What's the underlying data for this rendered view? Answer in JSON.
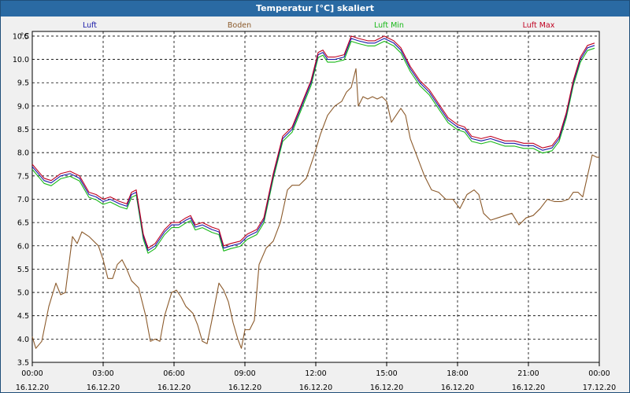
{
  "window": {
    "title": "Temperatur [°C] skaliert"
  },
  "chart_data": {
    "type": "line",
    "title": "Temperatur [°C] skaliert",
    "ylabel": "°C",
    "xlabel": "",
    "ylim": [
      3.5,
      10.6
    ],
    "xlim": [
      0,
      24
    ],
    "yticks": [
      3.5,
      4.0,
      4.5,
      5.0,
      5.5,
      6.0,
      6.5,
      7.0,
      7.5,
      8.0,
      8.5,
      9.0,
      9.5,
      10.0,
      10.5
    ],
    "ytick_labels": [
      "3.5",
      "4.0",
      "4.5",
      "5.0",
      "5.5",
      "6.0",
      "6.5",
      "7.0",
      "7.5",
      "8.0",
      "8.5",
      "9.0",
      "9.5",
      "10.0",
      "10.5"
    ],
    "xticks": [
      {
        "x": 0,
        "time": "00:00",
        "date": "16.12.20"
      },
      {
        "x": 3,
        "time": "03:00",
        "date": "16.12.20"
      },
      {
        "x": 6,
        "time": "06:00",
        "date": "16.12.20"
      },
      {
        "x": 9,
        "time": "09:00",
        "date": "16.12.20"
      },
      {
        "x": 12,
        "time": "12:00",
        "date": "16.12.20"
      },
      {
        "x": 15,
        "time": "15:00",
        "date": "16.12.20"
      },
      {
        "x": 18,
        "time": "18:00",
        "date": "16.12.20"
      },
      {
        "x": 21,
        "time": "21:00",
        "date": "16.12.20"
      },
      {
        "x": 24,
        "time": "00:00",
        "date": "17.12.20"
      }
    ],
    "grid": true,
    "legend_placement": "top",
    "series": [
      {
        "name": "Luft",
        "color": "#1a1aa8",
        "dy": 0.0,
        "points": [
          [
            0,
            7.7
          ],
          [
            0.5,
            7.4
          ],
          [
            0.8,
            7.35
          ],
          [
            1.2,
            7.5
          ],
          [
            1.6,
            7.55
          ],
          [
            2.0,
            7.45
          ],
          [
            2.4,
            7.1
          ],
          [
            2.7,
            7.05
          ],
          [
            3.0,
            6.95
          ],
          [
            3.3,
            7.0
          ],
          [
            3.7,
            6.9
          ],
          [
            4.0,
            6.85
          ],
          [
            4.2,
            7.1
          ],
          [
            4.4,
            7.15
          ],
          [
            4.7,
            6.2
          ],
          [
            4.9,
            5.9
          ],
          [
            5.2,
            6.0
          ],
          [
            5.6,
            6.3
          ],
          [
            5.9,
            6.45
          ],
          [
            6.2,
            6.45
          ],
          [
            6.5,
            6.55
          ],
          [
            6.7,
            6.6
          ],
          [
            6.9,
            6.4
          ],
          [
            7.2,
            6.45
          ],
          [
            7.6,
            6.35
          ],
          [
            7.9,
            6.3
          ],
          [
            8.1,
            5.95
          ],
          [
            8.4,
            6.0
          ],
          [
            8.8,
            6.05
          ],
          [
            9.1,
            6.2
          ],
          [
            9.5,
            6.3
          ],
          [
            9.8,
            6.55
          ],
          [
            10.2,
            7.5
          ],
          [
            10.6,
            8.3
          ],
          [
            11.0,
            8.5
          ],
          [
            11.4,
            9.0
          ],
          [
            11.8,
            9.5
          ],
          [
            12.1,
            10.1
          ],
          [
            12.3,
            10.15
          ],
          [
            12.5,
            10.0
          ],
          [
            12.8,
            10.0
          ],
          [
            13.2,
            10.05
          ],
          [
            13.5,
            10.45
          ],
          [
            13.8,
            10.4
          ],
          [
            14.2,
            10.35
          ],
          [
            14.5,
            10.35
          ],
          [
            14.9,
            10.45
          ],
          [
            15.3,
            10.35
          ],
          [
            15.6,
            10.2
          ],
          [
            16.0,
            9.8
          ],
          [
            16.4,
            9.5
          ],
          [
            16.8,
            9.3
          ],
          [
            17.2,
            9.0
          ],
          [
            17.6,
            8.7
          ],
          [
            18.0,
            8.55
          ],
          [
            18.3,
            8.5
          ],
          [
            18.6,
            8.3
          ],
          [
            19.0,
            8.25
          ],
          [
            19.4,
            8.3
          ],
          [
            19.7,
            8.25
          ],
          [
            20.0,
            8.2
          ],
          [
            20.4,
            8.2
          ],
          [
            20.8,
            8.15
          ],
          [
            21.2,
            8.15
          ],
          [
            21.6,
            8.05
          ],
          [
            22.0,
            8.1
          ],
          [
            22.3,
            8.3
          ],
          [
            22.6,
            8.8
          ],
          [
            22.9,
            9.5
          ],
          [
            23.2,
            10.0
          ],
          [
            23.5,
            10.25
          ],
          [
            23.8,
            10.3
          ]
        ]
      },
      {
        "name": "Boden",
        "color": "#8b5a2b",
        "dy": 0.0,
        "points": [
          [
            0,
            4.05
          ],
          [
            0.15,
            3.8
          ],
          [
            0.4,
            3.95
          ],
          [
            0.7,
            4.7
          ],
          [
            1.0,
            5.2
          ],
          [
            1.2,
            4.95
          ],
          [
            1.4,
            5.0
          ],
          [
            1.7,
            6.2
          ],
          [
            1.9,
            6.05
          ],
          [
            2.1,
            6.3
          ],
          [
            2.4,
            6.2
          ],
          [
            2.8,
            6.0
          ],
          [
            3.0,
            5.7
          ],
          [
            3.2,
            5.3
          ],
          [
            3.4,
            5.3
          ],
          [
            3.6,
            5.6
          ],
          [
            3.8,
            5.7
          ],
          [
            4.0,
            5.5
          ],
          [
            4.2,
            5.25
          ],
          [
            4.5,
            5.1
          ],
          [
            4.8,
            4.5
          ],
          [
            5.0,
            3.95
          ],
          [
            5.2,
            4.0
          ],
          [
            5.4,
            3.95
          ],
          [
            5.6,
            4.5
          ],
          [
            5.9,
            5.0
          ],
          [
            6.1,
            5.05
          ],
          [
            6.3,
            4.9
          ],
          [
            6.5,
            4.7
          ],
          [
            6.8,
            4.55
          ],
          [
            7.0,
            4.3
          ],
          [
            7.2,
            3.95
          ],
          [
            7.4,
            3.9
          ],
          [
            7.6,
            4.4
          ],
          [
            7.9,
            5.2
          ],
          [
            8.1,
            5.05
          ],
          [
            8.3,
            4.8
          ],
          [
            8.5,
            4.35
          ],
          [
            8.7,
            4.0
          ],
          [
            8.85,
            3.8
          ],
          [
            9.0,
            4.2
          ],
          [
            9.2,
            4.2
          ],
          [
            9.4,
            4.4
          ],
          [
            9.6,
            5.6
          ],
          [
            9.9,
            5.95
          ],
          [
            10.2,
            6.1
          ],
          [
            10.5,
            6.5
          ],
          [
            10.8,
            7.2
          ],
          [
            11.0,
            7.3
          ],
          [
            11.3,
            7.3
          ],
          [
            11.6,
            7.45
          ],
          [
            11.9,
            7.9
          ],
          [
            12.2,
            8.4
          ],
          [
            12.5,
            8.8
          ],
          [
            12.8,
            9.0
          ],
          [
            13.1,
            9.1
          ],
          [
            13.3,
            9.3
          ],
          [
            13.5,
            9.4
          ],
          [
            13.7,
            9.8
          ],
          [
            13.8,
            9.0
          ],
          [
            14.0,
            9.2
          ],
          [
            14.2,
            9.15
          ],
          [
            14.4,
            9.2
          ],
          [
            14.6,
            9.15
          ],
          [
            14.8,
            9.2
          ],
          [
            15.0,
            9.1
          ],
          [
            15.2,
            8.65
          ],
          [
            15.4,
            8.8
          ],
          [
            15.6,
            8.95
          ],
          [
            15.8,
            8.8
          ],
          [
            16.0,
            8.3
          ],
          [
            16.3,
            7.9
          ],
          [
            16.6,
            7.5
          ],
          [
            16.9,
            7.2
          ],
          [
            17.2,
            7.15
          ],
          [
            17.5,
            7.0
          ],
          [
            17.8,
            7.0
          ],
          [
            18.1,
            6.8
          ],
          [
            18.4,
            7.1
          ],
          [
            18.7,
            7.2
          ],
          [
            18.9,
            7.1
          ],
          [
            19.1,
            6.7
          ],
          [
            19.4,
            6.55
          ],
          [
            19.7,
            6.6
          ],
          [
            20.0,
            6.65
          ],
          [
            20.3,
            6.7
          ],
          [
            20.6,
            6.45
          ],
          [
            20.9,
            6.6
          ],
          [
            21.2,
            6.65
          ],
          [
            21.5,
            6.8
          ],
          [
            21.8,
            7.0
          ],
          [
            22.1,
            6.95
          ],
          [
            22.4,
            6.95
          ],
          [
            22.7,
            7.0
          ],
          [
            22.9,
            7.15
          ],
          [
            23.1,
            7.15
          ],
          [
            23.3,
            7.05
          ],
          [
            23.5,
            7.5
          ],
          [
            23.7,
            7.95
          ],
          [
            23.9,
            7.9
          ],
          [
            24.0,
            7.9
          ]
        ]
      },
      {
        "name": "Luft Min",
        "color": "#18b818",
        "dy": -0.06,
        "points": "Luft"
      },
      {
        "name": "Luft Max",
        "color": "#c00020",
        "dy": 0.05,
        "points": "Luft"
      }
    ]
  }
}
